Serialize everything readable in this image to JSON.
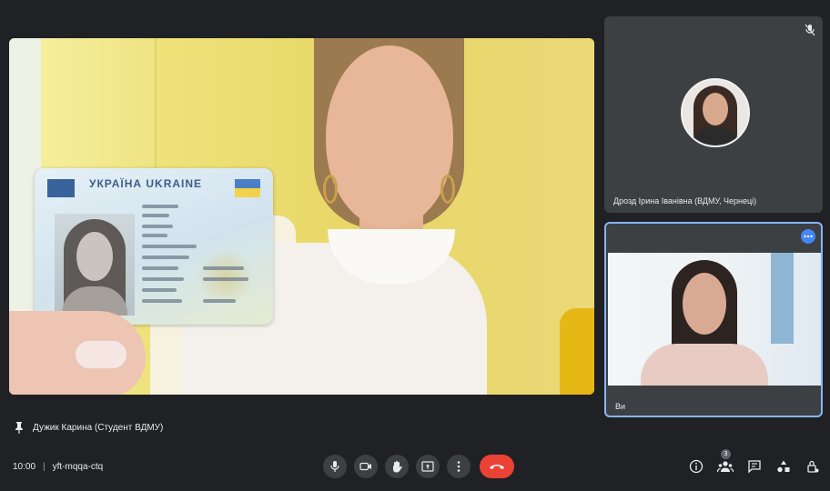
{
  "main_tile": {
    "id_card_title": "УКРАЇНА UKRAINE",
    "participant_name": "Дужик Карина (Студент ВДМУ)"
  },
  "side_tiles": [
    {
      "name": "Дрозд Ірина Іванівна (ВДМУ, Чернеці)",
      "muted": true
    },
    {
      "name": "Ви",
      "pinned_more": true
    }
  ],
  "bottom_bar": {
    "time": "10:00",
    "meeting_code": "yft-mqqa-ctq",
    "participants_count": "3"
  },
  "colors": {
    "background": "#202124",
    "tile": "#3c4043",
    "end_call": "#ea4335",
    "accent": "#8ab4f8"
  },
  "icons": {
    "controls": [
      "microphone-icon",
      "camera-icon",
      "raise-hand-icon",
      "present-icon",
      "more-options-icon",
      "end-call-icon"
    ],
    "right": [
      "info-icon",
      "people-icon",
      "chat-icon",
      "activities-icon",
      "host-controls-icon"
    ]
  }
}
